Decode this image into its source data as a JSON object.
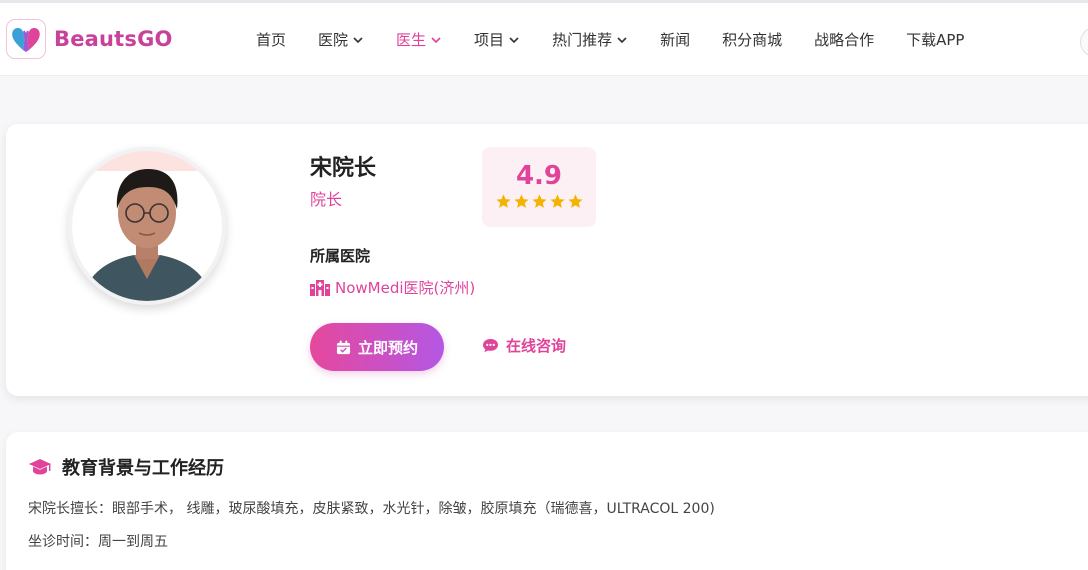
{
  "brand": {
    "name": "BeautsGO",
    "accent": "#e0449a",
    "logo_color": "#c8429c"
  },
  "nav": {
    "items": [
      {
        "label": "首页",
        "dropdown": false,
        "active": false
      },
      {
        "label": "医院",
        "dropdown": true,
        "active": false
      },
      {
        "label": "医生",
        "dropdown": true,
        "active": true
      },
      {
        "label": "项目",
        "dropdown": true,
        "active": false
      },
      {
        "label": "热门推荐",
        "dropdown": true,
        "active": false
      },
      {
        "label": "新闻",
        "dropdown": false,
        "active": false
      },
      {
        "label": "积分商城",
        "dropdown": false,
        "active": false
      },
      {
        "label": "战略合作",
        "dropdown": false,
        "active": false
      },
      {
        "label": "下载APP",
        "dropdown": false,
        "active": false
      }
    ]
  },
  "doctor": {
    "name": "宋院长",
    "title": "院长",
    "rating": "4.9",
    "stars": 5,
    "hospital_label": "所属医院",
    "hospital_name": "NowMedi医院(济州)",
    "book_label": "立即预约",
    "consult_label": "在线咨询"
  },
  "education": {
    "title": "教育背景与工作经历",
    "specialty_line": "宋院长擅长：眼部手术， 线雕，玻尿酸填充，皮肤紧致，水光针，除皱，胶原填充（瑞德喜，ULTRACOL 200)",
    "schedule_line": "坐诊时间：周一到周五"
  },
  "icons": {
    "logo": "heart-logo-icon",
    "chevron": "chevron-down-icon",
    "star": "star-icon",
    "hospital": "hospital-building-icon",
    "calendar": "calendar-check-icon",
    "chat": "chat-bubble-icon",
    "graduation": "graduation-cap-icon"
  }
}
